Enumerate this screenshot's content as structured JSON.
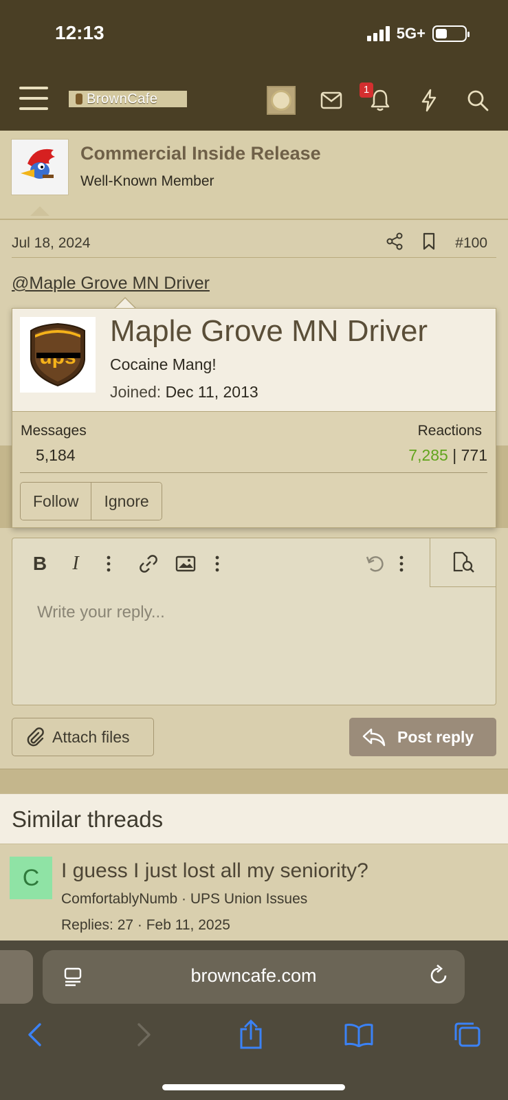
{
  "status_bar": {
    "time": "12:13",
    "network": "5G+"
  },
  "header": {
    "logo_text": "BrownCafe",
    "alerts_count": "1"
  },
  "post": {
    "author_name": "Commercial Inside Release",
    "author_title": "Well-Known Member",
    "date": "Jul 18, 2024",
    "post_number": "#100",
    "mention_text": "@Maple Grove MN Driver"
  },
  "member_card": {
    "name": "Maple Grove MN Driver",
    "custom_title": "Cocaine Mang!",
    "joined_label": "Joined:",
    "joined_date": "Dec 11, 2013",
    "messages_label": "Messages",
    "messages_value": "5,184",
    "reactions_label": "Reactions",
    "reactions_positive": "7,285",
    "reactions_separator": "|",
    "reactions_other": "771",
    "follow_label": "Follow",
    "ignore_label": "Ignore"
  },
  "editor": {
    "placeholder": "Write your reply...",
    "bold_label": "B",
    "italic_label": "I"
  },
  "actions": {
    "attach_label": "Attach files",
    "post_reply_label": "Post reply"
  },
  "similar": {
    "heading": "Similar threads",
    "threads": [
      {
        "avatar_letter": "C",
        "title": "I guess I just lost all my seniority?",
        "subtitle": "ComfortablyNumb · UPS Union Issues",
        "meta": "Replies: 27 · Feb 11, 2025"
      }
    ]
  },
  "browser": {
    "url": "browncafe.com"
  },
  "colors": {
    "header_bg": "#4a3f25",
    "page_bg": "#d9cfae",
    "reaction_positive": "#62a41d",
    "badge": "#d32f2f",
    "link_blue": "#3b82f6"
  }
}
